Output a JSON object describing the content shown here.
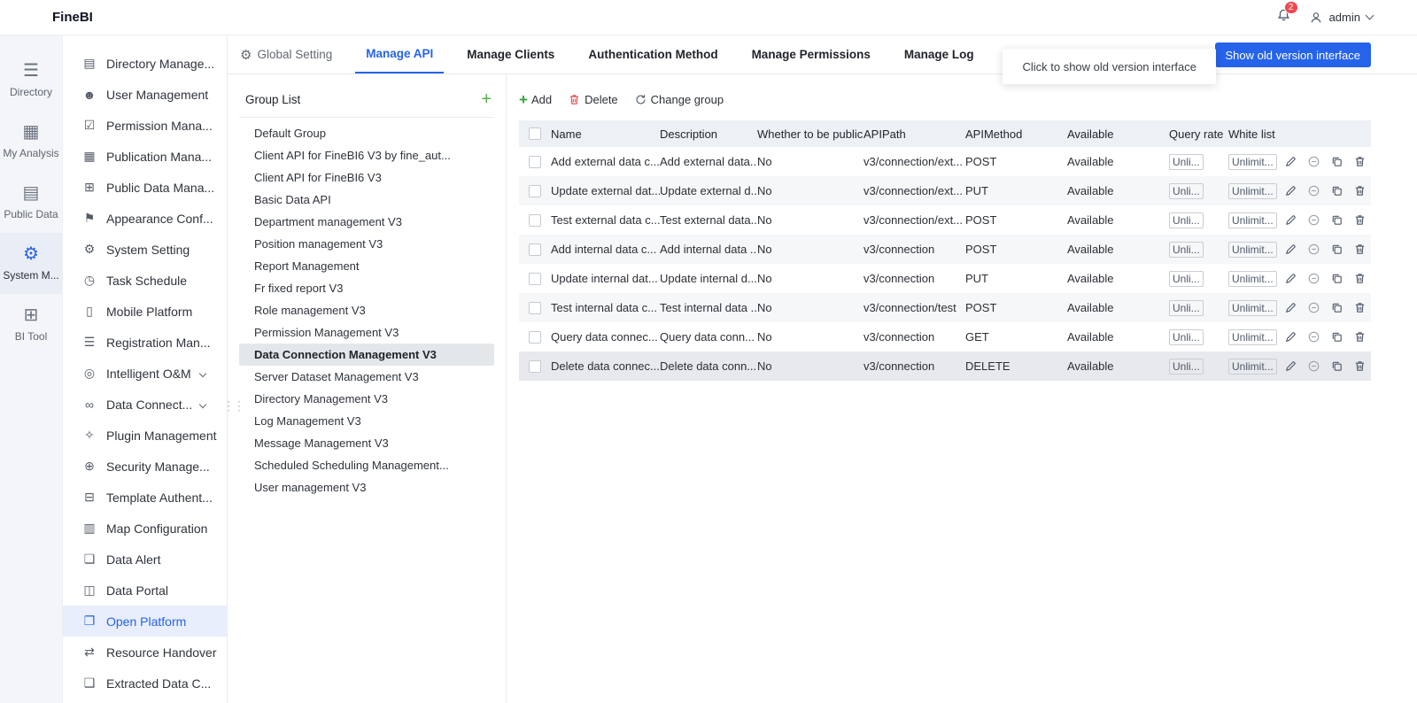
{
  "colors": {
    "accent": "#2563eb",
    "badge_red": "#f2484b",
    "add_green": "#2fa33c",
    "delete_red": "#e34d4d"
  },
  "topbar": {
    "logo": "FineBI",
    "user": "admin",
    "badge_count": "2"
  },
  "rail": {
    "items": [
      {
        "key": "directory",
        "icon": "directory-icon",
        "label": "Directory",
        "active": false
      },
      {
        "key": "my-analysis",
        "icon": "analysis-icon",
        "label": "My Analysis",
        "active": false
      },
      {
        "key": "public-data",
        "icon": "public-data-icon",
        "label": "Public Data",
        "active": false
      },
      {
        "key": "system-management",
        "icon": "system-icon",
        "label": "System M...",
        "active": true
      },
      {
        "key": "bi-tool",
        "icon": "bi-tool-icon",
        "label": "BI Tool",
        "active": false
      }
    ]
  },
  "sidebar": {
    "items": [
      {
        "key": "directory-management",
        "label": "Directory Manage...",
        "icon": "folder"
      },
      {
        "key": "user-management",
        "label": "User Management",
        "icon": "user"
      },
      {
        "key": "permission-management",
        "label": "Permission Mana...",
        "icon": "permission"
      },
      {
        "key": "publication-management",
        "label": "Publication Mana...",
        "icon": "publication"
      },
      {
        "key": "public-data-management",
        "label": "Public Data Mana...",
        "icon": "public-data"
      },
      {
        "key": "appearance-config",
        "label": "Appearance Conf...",
        "icon": "appearance"
      },
      {
        "key": "system-setting",
        "label": "System Setting",
        "icon": "gear"
      },
      {
        "key": "task-schedule",
        "label": "Task Schedule",
        "icon": "clock"
      },
      {
        "key": "mobile-platform",
        "label": "Mobile Platform",
        "icon": "mobile"
      },
      {
        "key": "registration-management",
        "label": "Registration Man...",
        "icon": "registration"
      },
      {
        "key": "intelligent-om",
        "label": "Intelligent O&M",
        "icon": "intelligent",
        "chevron": true
      },
      {
        "key": "data-connect",
        "label": "Data Connect...",
        "icon": "data-connect",
        "chevron": true
      },
      {
        "key": "plugin-management",
        "label": "Plugin Management",
        "icon": "plugin"
      },
      {
        "key": "security-management",
        "label": "Security Manage...",
        "icon": "security"
      },
      {
        "key": "template-authentication",
        "label": "Template Authent...",
        "icon": "template"
      },
      {
        "key": "map-configuration",
        "label": "Map Configuration",
        "icon": "map"
      },
      {
        "key": "data-alert",
        "label": "Data Alert",
        "icon": "alert"
      },
      {
        "key": "data-portal",
        "label": "Data Portal",
        "icon": "portal"
      },
      {
        "key": "open-platform",
        "label": "Open Platform",
        "icon": "open-platform",
        "selected": true
      },
      {
        "key": "resource-handover",
        "label": "Resource Handover",
        "icon": "handover"
      },
      {
        "key": "extracted-data",
        "label": "Extracted Data C...",
        "icon": "extracted"
      }
    ]
  },
  "tabs": {
    "items": [
      {
        "key": "global-setting",
        "label": "Global Setting"
      },
      {
        "key": "manage-api",
        "label": "Manage API",
        "active": true
      },
      {
        "key": "manage-clients",
        "label": "Manage Clients"
      },
      {
        "key": "authentication-method",
        "label": "Authentication Method"
      },
      {
        "key": "manage-permissions",
        "label": "Manage Permissions"
      },
      {
        "key": "manage-log",
        "label": "Manage Log"
      }
    ]
  },
  "tooltip": {
    "text": "Click to show old version interface"
  },
  "old_version_button": {
    "label": "Show old version interface"
  },
  "group_panel": {
    "title": "Group List",
    "items": [
      {
        "label": "Default Group"
      },
      {
        "label": "Client API for FineBI6 V3 by fine_aut..."
      },
      {
        "label": "Client API for FineBI6 V3"
      },
      {
        "label": "Basic Data API"
      },
      {
        "label": "Department management V3"
      },
      {
        "label": "Position management V3"
      },
      {
        "label": "Report Management"
      },
      {
        "label": "Fr fixed report V3"
      },
      {
        "label": "Role management V3"
      },
      {
        "label": "Permission Management V3"
      },
      {
        "label": "Data Connection Management V3",
        "selected": true
      },
      {
        "label": "Server Dataset Management V3"
      },
      {
        "label": "Directory Management V3"
      },
      {
        "label": "Log Management V3"
      },
      {
        "label": "Message Management V3"
      },
      {
        "label": "Scheduled Scheduling Management..."
      },
      {
        "label": "User management V3"
      }
    ]
  },
  "toolbar": {
    "add_label": "Add",
    "delete_label": "Delete",
    "change_group_label": "Change group"
  },
  "table": {
    "headers": {
      "name": "Name",
      "description": "Description",
      "public": "Whether to be public",
      "api_path": "APIPath",
      "api_method": "APIMethod",
      "available": "Available",
      "query_rate": "Query rate",
      "white_list": "White list"
    },
    "rows": [
      {
        "name": "Add external data c...",
        "description": "Add external data...",
        "public": "No",
        "api_path": "v3/connection/ext...",
        "api_method": "POST",
        "available": "Available",
        "query_rate": "Unli...",
        "white_list": "Unlimit..."
      },
      {
        "name": "Update external dat...",
        "description": "Update external d...",
        "public": "No",
        "api_path": "v3/connection/ext...",
        "api_method": "PUT",
        "available": "Available",
        "query_rate": "Unli...",
        "white_list": "Unlimit..."
      },
      {
        "name": "Test external data c...",
        "description": "Test external data...",
        "public": "No",
        "api_path": "v3/connection/ext...",
        "api_method": "POST",
        "available": "Available",
        "query_rate": "Unli...",
        "white_list": "Unlimit..."
      },
      {
        "name": "Add internal data c...",
        "description": "Add internal data ...",
        "public": "No",
        "api_path": "v3/connection",
        "api_method": "POST",
        "available": "Available",
        "query_rate": "Unli...",
        "white_list": "Unlimit..."
      },
      {
        "name": "Update internal dat...",
        "description": "Update internal d...",
        "public": "No",
        "api_path": "v3/connection",
        "api_method": "PUT",
        "available": "Available",
        "query_rate": "Unli...",
        "white_list": "Unlimit..."
      },
      {
        "name": "Test internal data c...",
        "description": "Test internal data ...",
        "public": "No",
        "api_path": "v3/connection/test",
        "api_method": "POST",
        "available": "Available",
        "query_rate": "Unli...",
        "white_list": "Unlimit..."
      },
      {
        "name": "Query data connec...",
        "description": "Query data conn...",
        "public": "No",
        "api_path": "v3/connection",
        "api_method": "GET",
        "available": "Available",
        "query_rate": "Unli...",
        "white_list": "Unlimit..."
      },
      {
        "name": "Delete data connec...",
        "description": "Delete data conn...",
        "public": "No",
        "api_path": "v3/connection",
        "api_method": "DELETE",
        "available": "Available",
        "query_rate": "Unli...",
        "white_list": "Unlimit...",
        "highlighted": true
      }
    ]
  }
}
